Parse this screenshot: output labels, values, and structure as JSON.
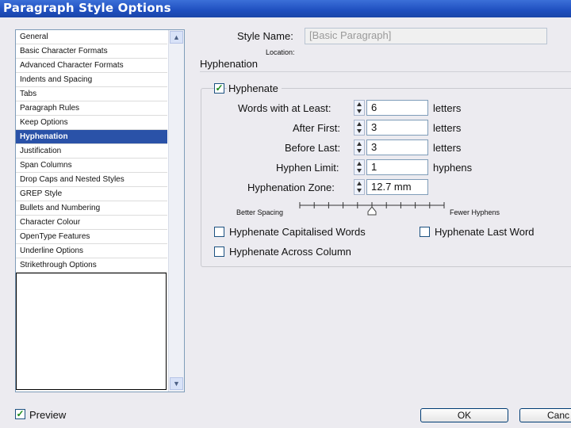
{
  "window": {
    "title": "Paragraph Style Options"
  },
  "sidebar": {
    "items": [
      {
        "label": "General"
      },
      {
        "label": "Basic Character Formats"
      },
      {
        "label": "Advanced Character Formats"
      },
      {
        "label": "Indents and Spacing"
      },
      {
        "label": "Tabs"
      },
      {
        "label": "Paragraph Rules"
      },
      {
        "label": "Keep Options"
      },
      {
        "label": "Hyphenation",
        "selected": true
      },
      {
        "label": "Justification"
      },
      {
        "label": "Span Columns"
      },
      {
        "label": "Drop Caps and Nested Styles"
      },
      {
        "label": "GREP Style"
      },
      {
        "label": "Bullets and Numbering"
      },
      {
        "label": "Character Colour"
      },
      {
        "label": "OpenType Features"
      },
      {
        "label": "Underline Options"
      },
      {
        "label": "Strikethrough Options"
      }
    ]
  },
  "header": {
    "style_name_label": "Style Name:",
    "style_name_value": "[Basic Paragraph]",
    "location_label": "Location:",
    "section_title": "Hyphenation"
  },
  "hyphenation": {
    "enabled_label": "Hyphenate",
    "enabled": true,
    "words_label": "Words with at Least:",
    "words_value": "6",
    "words_unit": "letters",
    "after_label": "After First:",
    "after_value": "3",
    "after_unit": "letters",
    "before_label": "Before Last:",
    "before_value": "3",
    "before_unit": "letters",
    "limit_label": "Hyphen Limit:",
    "limit_value": "1",
    "limit_unit": "hyphens",
    "zone_label": "Hyphenation Zone:",
    "zone_value": "12.7 mm",
    "slider_left_label": "Better Spacing",
    "slider_right_label": "Fewer Hyphens",
    "slider_value": 0.5,
    "cap_words_label": "Hyphenate Capitalised Words",
    "cap_words": false,
    "last_word_label": "Hyphenate Last Word",
    "last_word": false,
    "across_column_label": "Hyphenate Across Column",
    "across_column": false
  },
  "footer": {
    "preview_label": "Preview",
    "preview": true,
    "ok_label": "OK",
    "cancel_label": "Canc"
  }
}
